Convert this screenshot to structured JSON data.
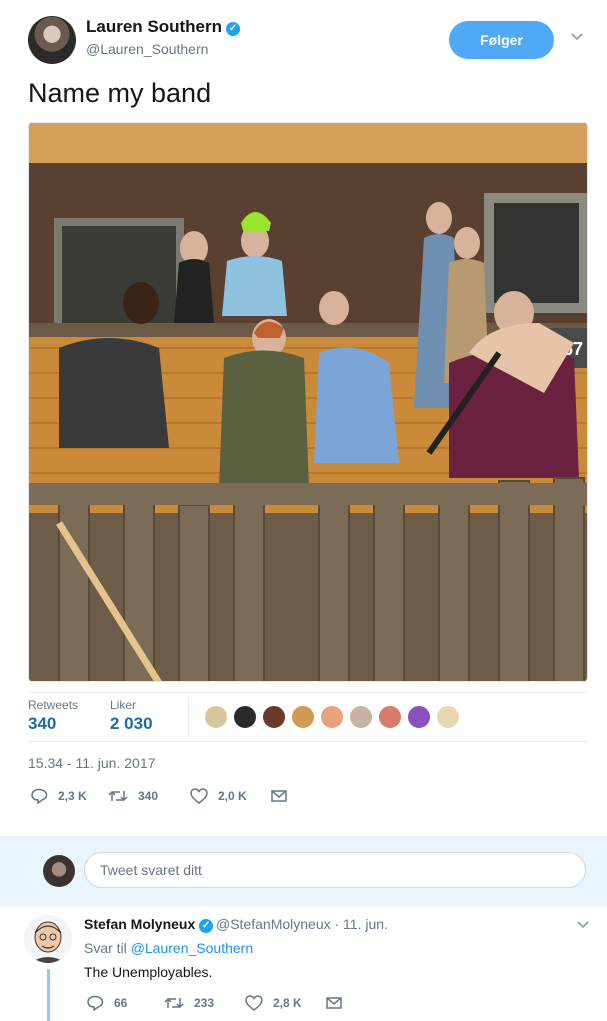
{
  "tweet": {
    "author": {
      "name": "Lauren Southern",
      "handle": "@Lauren_Southern"
    },
    "follow_label": "Følger",
    "text": "Name my band",
    "stats": {
      "retweets_label": "Retweets",
      "retweets_value": "340",
      "likes_label": "Liker",
      "likes_value": "2 030"
    },
    "timestamp": "15.34 - 11. jun. 2017",
    "actions": {
      "replies": "2,3 K",
      "retweets": "340",
      "likes": "2,0 K"
    },
    "likers_icons": [
      "liker-avatar",
      "liker-avatar",
      "liker-avatar",
      "liker-avatar",
      "liker-avatar",
      "liker-avatar",
      "liker-avatar",
      "liker-avatar",
      "liker-avatar"
    ]
  },
  "reply_box": {
    "placeholder": "Tweet svaret ditt"
  },
  "reply": {
    "author_name": "Stefan Molyneux",
    "handle_time": "@StefanMolyneux · 11. jun.",
    "replying_prefix": "Svar til",
    "replying_to": "@Lauren_Southern",
    "text": "The Unemployables.",
    "actions": {
      "replies": "66",
      "retweets": "233",
      "likes": "2,8 K"
    }
  },
  "colors": {
    "accent": "#1da1f2",
    "follow_button": "#4fa9f4",
    "muted_text": "#657786",
    "stat_value": "#1b6aa5",
    "reply_band": "#e8f5fd"
  }
}
